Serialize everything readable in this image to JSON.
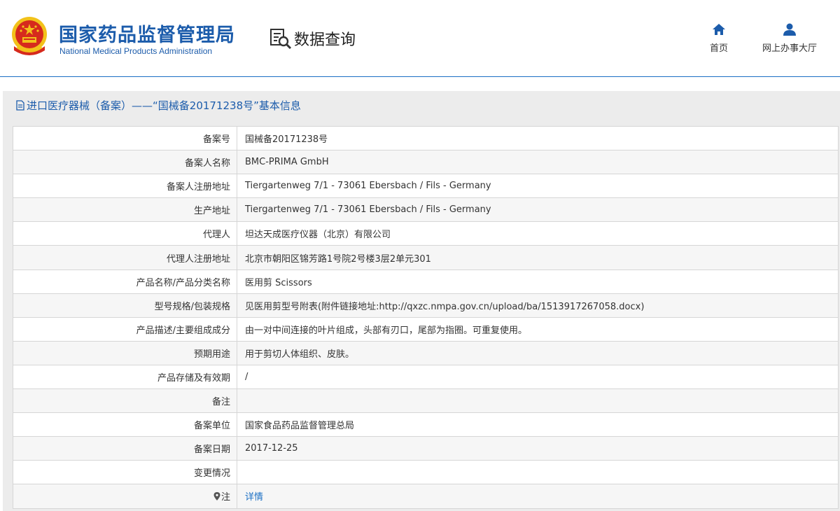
{
  "header": {
    "org_name_cn": "国家药品监督管理局",
    "org_name_en": "National Medical Products Administration",
    "query_label": "数据查询",
    "nav": {
      "home_label": "首页",
      "hall_label": "网上办事大厅"
    }
  },
  "colors": {
    "brand": "#1c5cab",
    "link": "#1a6fc4",
    "emblem_red": "#d62a1d",
    "emblem_gold": "#f2c21a"
  },
  "icons": {
    "emblem": "national-emblem-icon",
    "query": "document-search-icon",
    "home": "home-icon",
    "hall": "user-icon",
    "title": "document-icon",
    "note": "map-pin-icon"
  },
  "panel": {
    "title": "进口医疗器械（备案）——“国械备20171238号”基本信息"
  },
  "record": {
    "rows": [
      {
        "label": "备案号",
        "value": "国械备20171238号"
      },
      {
        "label": "备案人名称",
        "value": "BMC-PRIMA GmbH"
      },
      {
        "label": "备案人注册地址",
        "value": "Tiergartenweg 7/1 - 73061 Ebersbach / Fils - Germany"
      },
      {
        "label": "生产地址",
        "value": "Tiergartenweg 7/1 - 73061 Ebersbach / Fils - Germany"
      },
      {
        "label": "代理人",
        "value": "坦达天成医疗仪器（北京）有限公司"
      },
      {
        "label": "代理人注册地址",
        "value": "北京市朝阳区锦芳路1号院2号楼3层2单元301"
      },
      {
        "label": "产品名称/产品分类名称",
        "value": "医用剪 Scissors"
      },
      {
        "label": "型号规格/包装规格",
        "value": "见医用剪型号附表(附件链接地址:http://qxzc.nmpa.gov.cn/upload/ba/1513917267058.docx)"
      },
      {
        "label": "产品描述/主要组成成分",
        "value": "由一对中间连接的叶片组成，头部有刃口，尾部为指圈。可重复使用。"
      },
      {
        "label": "预期用途",
        "value": "用于剪切人体组织、皮肤。"
      },
      {
        "label": "产品存储及有效期",
        "value": "/"
      },
      {
        "label": "备注",
        "value": ""
      },
      {
        "label": "备案单位",
        "value": "国家食品药品监督管理总局"
      },
      {
        "label": "备案日期",
        "value": "2017-12-25"
      },
      {
        "label": "变更情况",
        "value": ""
      }
    ],
    "note": {
      "label": "注",
      "link_label": "详情"
    }
  }
}
